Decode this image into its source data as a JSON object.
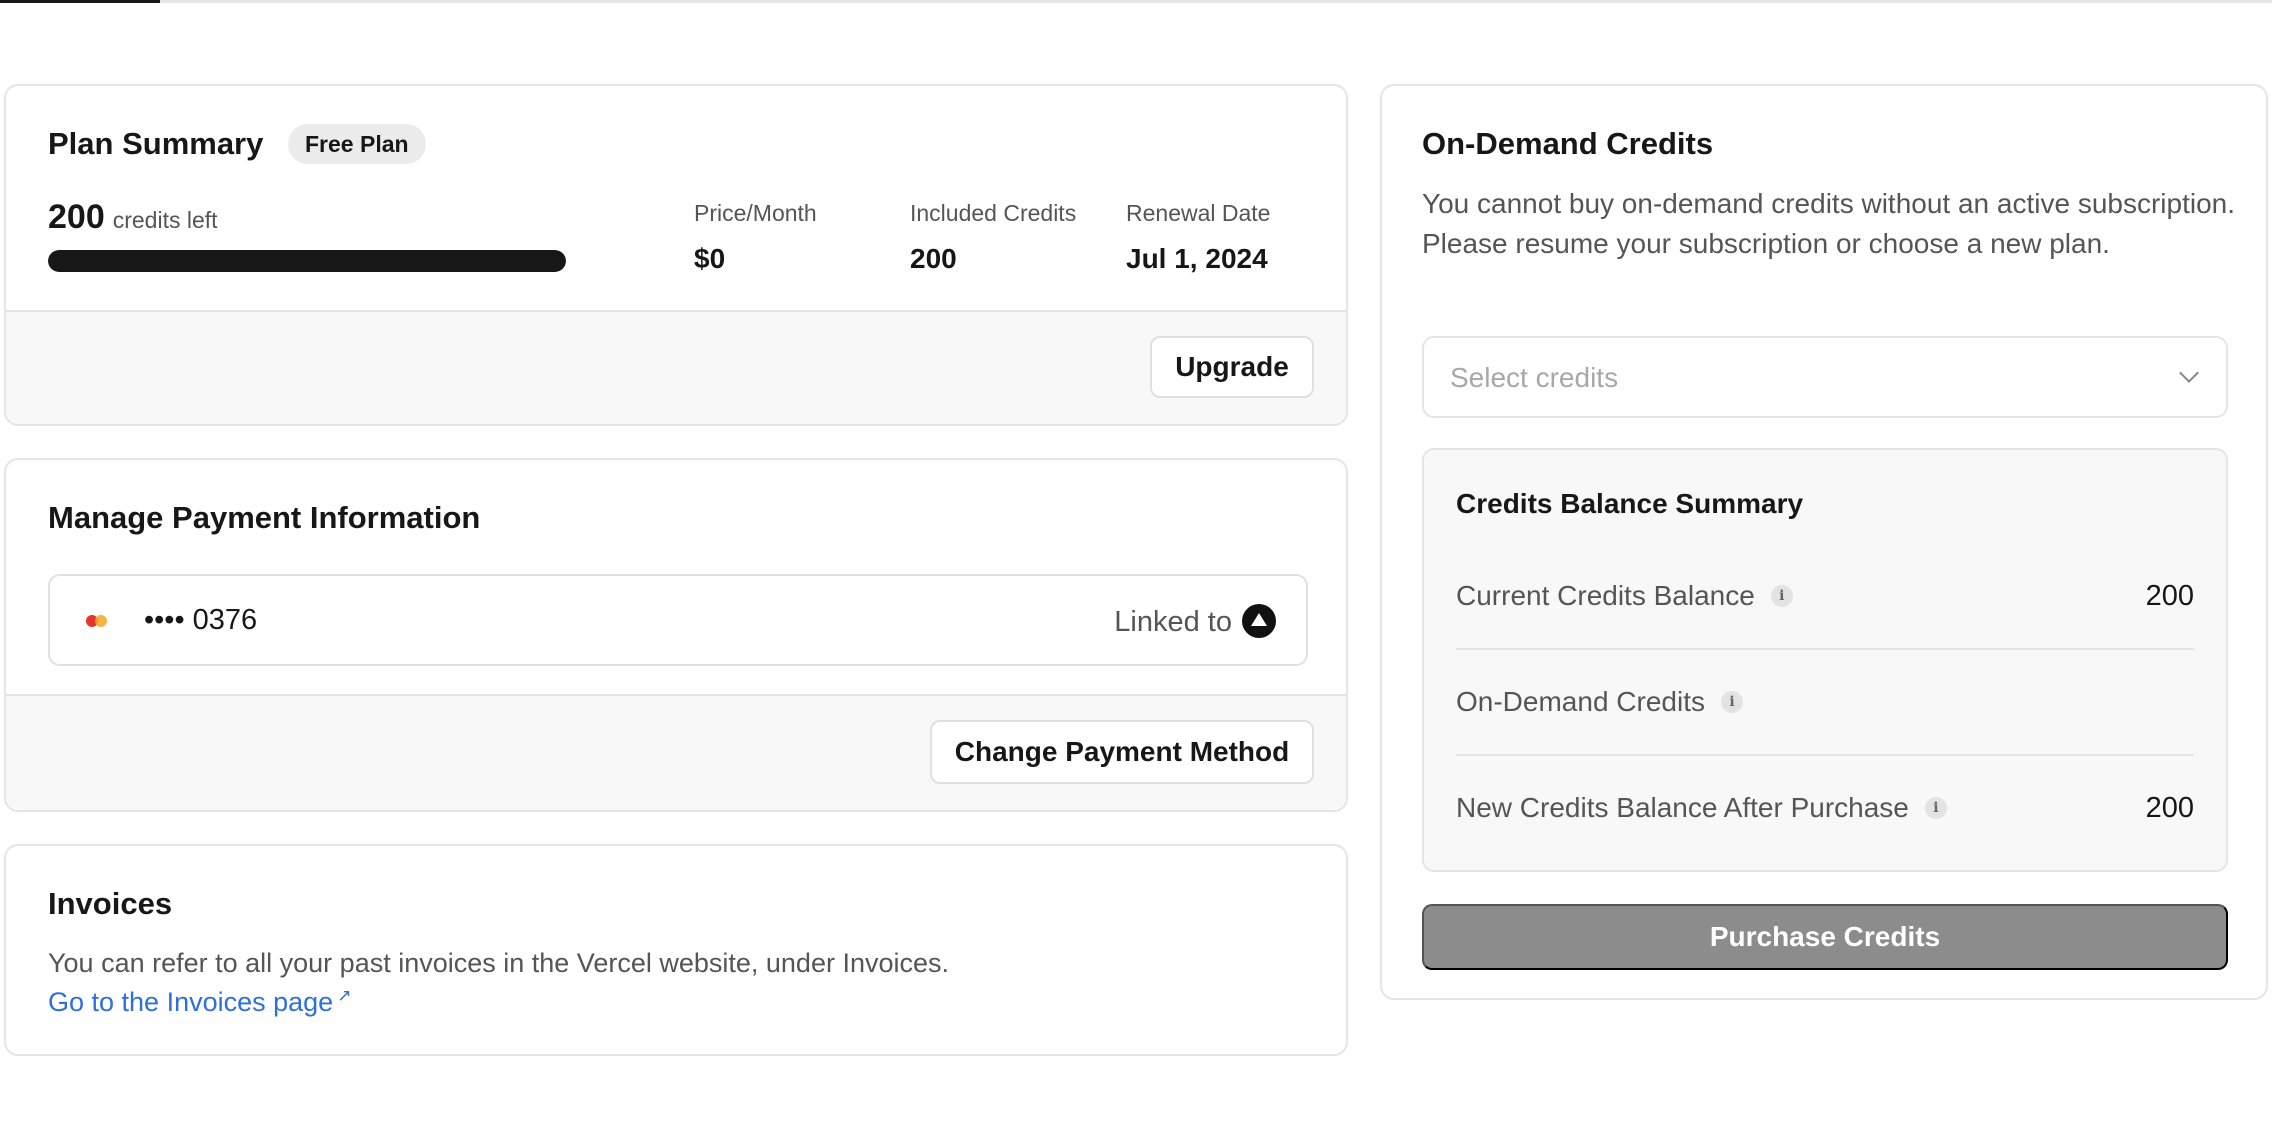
{
  "plan_summary": {
    "title": "Plan Summary",
    "badge": "Free Plan",
    "credits_left_value": "200",
    "credits_left_label": "credits left",
    "credits_progress_fraction": 1.0,
    "stats": [
      {
        "label": "Price/Month",
        "value": "$0"
      },
      {
        "label": "Included Credits",
        "value": "200"
      },
      {
        "label": "Renewal Date",
        "value": "Jul 1, 2024"
      }
    ],
    "upgrade_label": "Upgrade"
  },
  "payment": {
    "title": "Manage Payment Information",
    "card_brand_icon": "mastercard-icon",
    "card_number": "•••• 0376",
    "linked_label": "Linked to",
    "linked_icon": "vercel-logo-icon",
    "change_label": "Change Payment Method"
  },
  "invoices": {
    "title": "Invoices",
    "text": "You can refer to all your past invoices in the Vercel website, under Invoices.",
    "link_label": "Go to the Invoices page",
    "link_icon": "external-link-icon"
  },
  "on_demand": {
    "title": "On-Demand Credits",
    "description": "You cannot buy on-demand credits without an active subscription. Please resume your subscription or choose a new plan.",
    "select_placeholder": "Select credits",
    "summary_title": "Credits Balance Summary",
    "rows": [
      {
        "label": "Current Credits Balance",
        "value": "200"
      },
      {
        "label": "On-Demand Credits",
        "value": ""
      },
      {
        "label": "New Credits Balance After Purchase",
        "value": "200"
      }
    ],
    "purchase_label": "Purchase Credits"
  },
  "colors": {
    "primary": "#171717",
    "link": "#2f6fdb",
    "disabled_button": "#8c8c8c"
  }
}
